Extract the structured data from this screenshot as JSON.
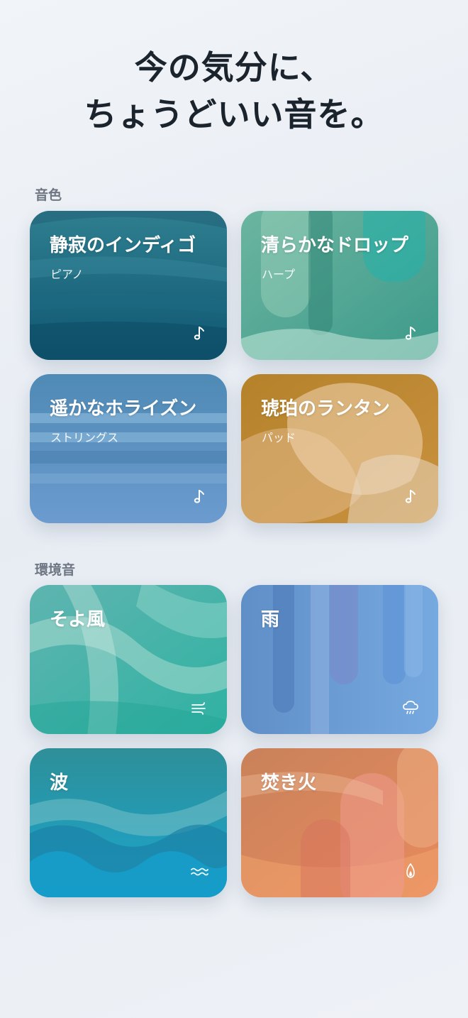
{
  "headline": {
    "line1": "今の気分に、",
    "line2": "ちょうどいい音を。"
  },
  "sections": {
    "tones": {
      "label": "音色"
    },
    "ambient": {
      "label": "環境音"
    }
  },
  "tones": [
    {
      "title": "静寂のインディゴ",
      "subtitle": "ピアノ",
      "icon": "music-note-icon"
    },
    {
      "title": "清らかなドロップ",
      "subtitle": "ハープ",
      "icon": "music-note-icon"
    },
    {
      "title": "遥かなホライズン",
      "subtitle": "ストリングス",
      "icon": "music-note-icon"
    },
    {
      "title": "琥珀のランタン",
      "subtitle": "パッド",
      "icon": "music-note-icon"
    }
  ],
  "ambient": [
    {
      "title": "そよ風",
      "icon": "wind-icon"
    },
    {
      "title": "雨",
      "icon": "rain-cloud-icon"
    },
    {
      "title": "波",
      "icon": "waves-icon"
    },
    {
      "title": "焚き火",
      "icon": "flame-icon"
    }
  ]
}
